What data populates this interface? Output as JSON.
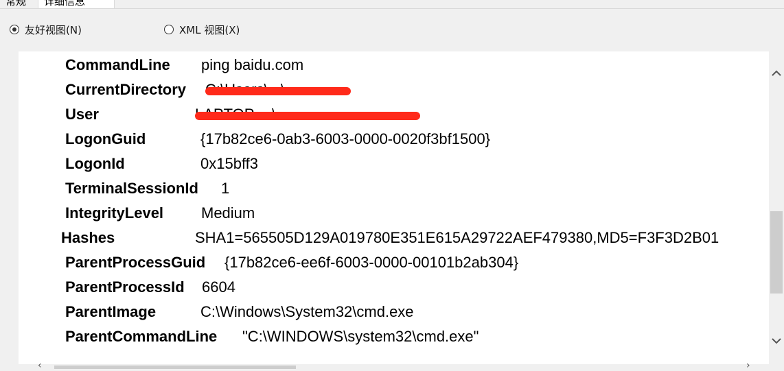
{
  "tabs": [
    {
      "label": "常规"
    },
    {
      "label": "详细信息"
    }
  ],
  "view_options": {
    "friendly": {
      "label": "友好视图(N)",
      "selected": true
    },
    "xml": {
      "label": "XML 视图(X)",
      "selected": false
    }
  },
  "fields": [
    {
      "key": "CommandLine",
      "value": "ping baidu.com",
      "redacted": false
    },
    {
      "key": "CurrentDirectory",
      "value": "C:\\Users\\...\\",
      "redacted": true
    },
    {
      "key": "User",
      "value": "LAPTOP-...\\...",
      "redacted": true
    },
    {
      "key": "LogonGuid",
      "value": "{17b82ce6-0ab3-6003-0000-0020f3bf1500}",
      "redacted": false
    },
    {
      "key": "LogonId",
      "value": "0x15bff3",
      "redacted": false
    },
    {
      "key": "TerminalSessionId",
      "value": "1",
      "redacted": false
    },
    {
      "key": "IntegrityLevel",
      "value": "Medium",
      "redacted": false
    },
    {
      "key": "Hashes",
      "value": "SHA1=565505D129A019780E351E615A29722AEF479380,MD5=F3F3D2B01",
      "redacted": false
    },
    {
      "key": "ParentProcessGuid",
      "value": "{17b82ce6-ee6f-6003-0000-00101b2ab304}",
      "redacted": false
    },
    {
      "key": "ParentProcessId",
      "value": "6604",
      "redacted": false
    },
    {
      "key": "ParentImage",
      "value": "C:\\Windows\\System32\\cmd.exe",
      "redacted": false
    },
    {
      "key": "ParentCommandLine",
      "value": "\"C:\\WINDOWS\\system32\\cmd.exe\"",
      "redacted": false
    }
  ],
  "colors": {
    "redaction": "#ff2a1a",
    "pane_bg": "#ffffff",
    "window_bg": "#f0f0f0"
  },
  "icons": {
    "scroll_up": "chevron-up-icon",
    "scroll_down": "chevron-down-icon"
  }
}
